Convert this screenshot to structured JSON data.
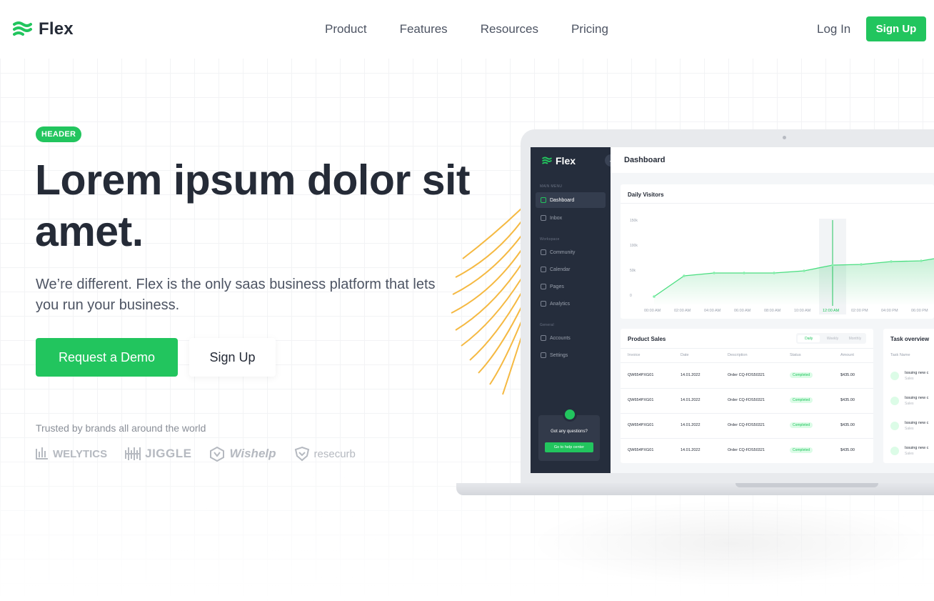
{
  "nav": {
    "brand": "Flex",
    "links": [
      "Product",
      "Features",
      "Resources",
      "Pricing"
    ],
    "login": "Log In",
    "signup": "Sign Up"
  },
  "hero": {
    "badge": "HEADER",
    "headline": "Lorem ipsum dolor sit amet.",
    "subtext": "We’re different. Flex is the only saas business platform that lets you run your business.",
    "cta_primary": "Request a Demo",
    "cta_secondary": "Sign Up",
    "trusted": "Trusted by brands all around the world",
    "brands": [
      "WELYTICS",
      "JIGGLE",
      "Wishelp",
      "resecurb"
    ]
  },
  "dashboard": {
    "brand": "Flex",
    "title": "Dashboard",
    "sidebar": {
      "section_main": "MAIN MENU",
      "section_workspace": "Workspace",
      "section_general": "General",
      "items": [
        "Dashboard",
        "Inbox",
        "Community",
        "Calendar",
        "Pages",
        "Analytics",
        "Accounts",
        "Settings"
      ],
      "help_text": "Got any questions?",
      "help_button": "Go to help center"
    },
    "visitors": {
      "title": "Daily Visitors",
      "y_ticks": [
        "150k",
        "100k",
        "50k",
        "0"
      ],
      "x_ticks": [
        "00:00 AM",
        "02:00 AM",
        "04:00 AM",
        "06:00 AM",
        "08:00 AM",
        "10:00 AM",
        "12:00 AM",
        "02:00 PM",
        "04:00 PM",
        "06:00 PM"
      ]
    },
    "sales": {
      "title": "Product Sales",
      "tabs": [
        "Daily",
        "Weekly",
        "Monthly"
      ],
      "columns": [
        "Invoice",
        "Date",
        "Description",
        "Status",
        "Amount"
      ],
      "rows": [
        {
          "invoice": "QW654PXG01",
          "date": "14.01.2022",
          "desc": "Order CQ-FDS50321",
          "status": "Completed",
          "amount": "$435.00"
        },
        {
          "invoice": "QW654PXG01",
          "date": "14.01.2022",
          "desc": "Order CQ-FDS50321",
          "status": "Completed",
          "amount": "$435.00"
        },
        {
          "invoice": "QW654PXG01",
          "date": "14.01.2022",
          "desc": "Order CQ-FDS50321",
          "status": "Completed",
          "amount": "$435.00"
        },
        {
          "invoice": "QW654PXG01",
          "date": "14.01.2022",
          "desc": "Order CQ-FDS50321",
          "status": "Completed",
          "amount": "$435.00"
        }
      ]
    },
    "tasks": {
      "title": "Task overview",
      "column": "Task Name",
      "items": [
        {
          "name": "Issuing new c",
          "sub": "Sales"
        },
        {
          "name": "Issuing new c",
          "sub": "Sales"
        },
        {
          "name": "Issuing new c",
          "sub": "Sales"
        },
        {
          "name": "Issuing new c",
          "sub": "Sales"
        }
      ]
    }
  },
  "colors": {
    "accent": "#22c55e",
    "dark": "#252b37",
    "sidebar": "#252d3c",
    "arc": "#f5b942"
  }
}
